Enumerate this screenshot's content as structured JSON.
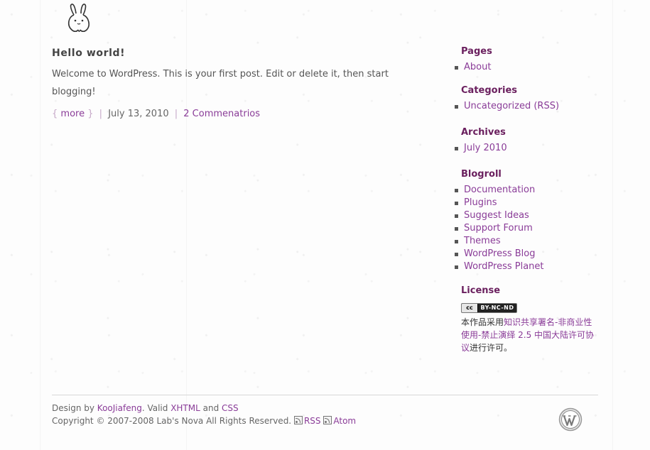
{
  "post": {
    "title": "Hello world!",
    "body": "Welcome to WordPress. This is your first post. Edit or delete it, then start blogging!",
    "more_open": "{",
    "more_label": "more",
    "more_close": "}",
    "date": "July 13, 2010",
    "comments": "2 Commenatrios"
  },
  "sidebar": {
    "pages_title": "Pages",
    "pages": [
      "About"
    ],
    "categories_title": "Categories",
    "category": "Uncategorized",
    "category_rss": "(RSS)",
    "archives_title": "Archives",
    "archives": [
      "July 2010"
    ],
    "blogroll_title": "Blogroll",
    "blogroll": [
      "Documentation",
      "Plugins",
      "Suggest Ideas",
      "Support Forum",
      "Themes",
      "WordPress Blog",
      "WordPress Planet"
    ],
    "license_title": "License",
    "cc_badge_left": "cc",
    "cc_badge_terms": "BY-NC-ND",
    "license_prefix": "本作品采用",
    "license_link": "知识共享署名-非商业性使用-禁止演绎 2.5 中国大陆许可协议",
    "license_suffix": "进行许可。"
  },
  "footer": {
    "design_by": "Design by",
    "designer": "KooJiafeng",
    "valid": ". Valid",
    "xhtml": "XHTML",
    "and": "and",
    "css": "CSS",
    "copyright": "Copyright © 2007-2008 Lab's Nova All Rights Reserved.",
    "rss": "RSS",
    "atom": "Atom"
  },
  "colors": {
    "link": "#8a3c98",
    "widget_title": "#6a1f5e",
    "text": "#555555"
  },
  "icons": [
    "bunny-logo-icon",
    "rss-feed-icon",
    "atom-feed-icon",
    "wordpress-logo-icon",
    "creative-commons-badge-icon"
  ]
}
